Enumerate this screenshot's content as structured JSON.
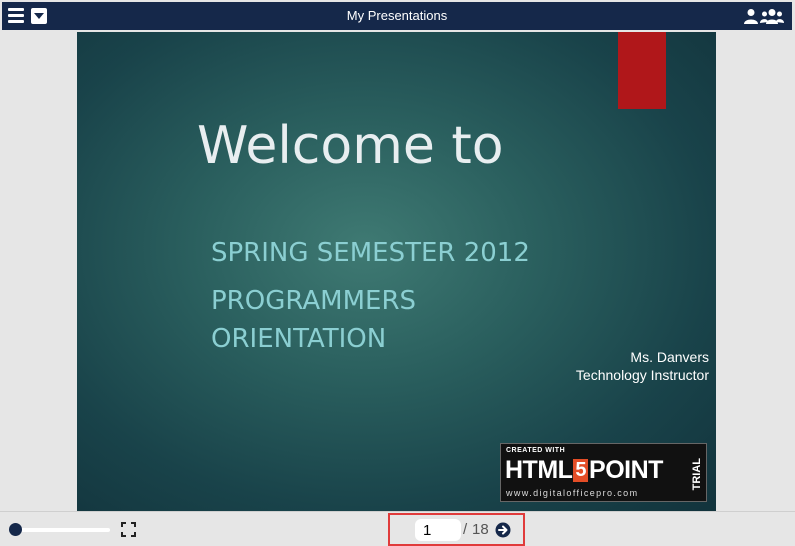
{
  "app": {
    "title": "My Presentations"
  },
  "slide": {
    "title": "Welcome to",
    "subtitle_line1": "SPRING SEMESTER 2012",
    "subtitle_line2": "PROGRAMMERS ORIENTATION",
    "presenter_name": "Ms. Danvers",
    "presenter_role": "Technology Instructor",
    "accent_color": "#b0171a",
    "background_color": "#2a5f5e",
    "watermark": {
      "created_with": "CREATED WITH",
      "logo_left": "HTML",
      "logo_five": "5",
      "logo_right": "POINT",
      "trial": "TRIAL",
      "url": "www.digitalofficepro.com"
    }
  },
  "navigation": {
    "current_page": "1",
    "separator": "/",
    "total_pages": "18",
    "slider_position": 0
  },
  "icons": {
    "menu": "menu-icon",
    "dropdown": "dropdown-icon",
    "user": "user-icon",
    "group": "group-icon",
    "fullscreen": "fullscreen-icon",
    "next": "arrow-right-circle-icon"
  },
  "colors": {
    "titlebar": "#15284a",
    "highlight": "#e03b3b"
  }
}
